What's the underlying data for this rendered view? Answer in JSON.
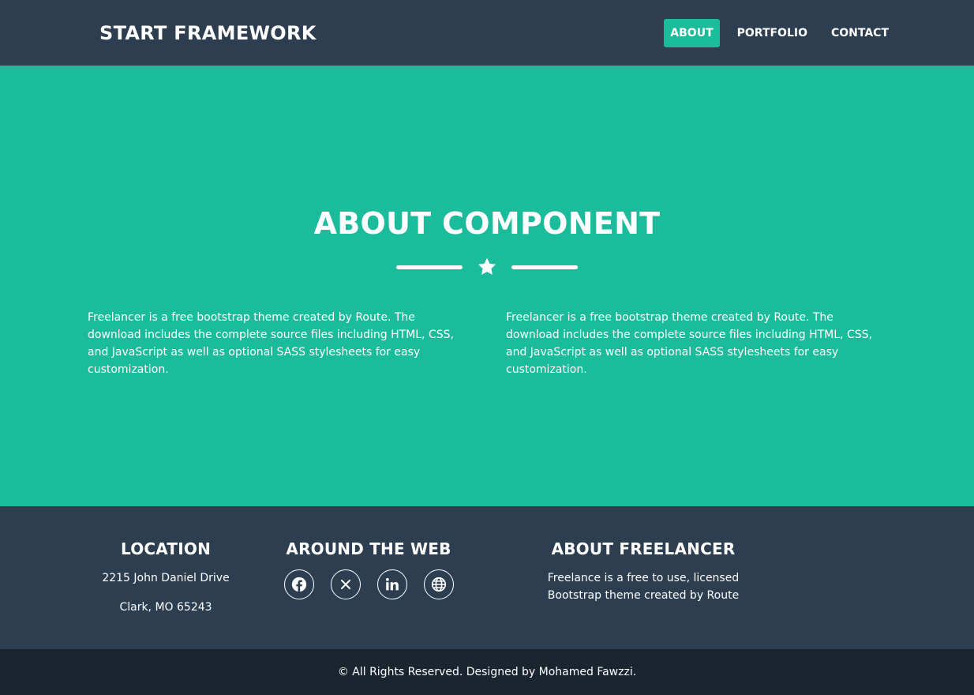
{
  "nav": {
    "brand": "START FRAMEWORK",
    "items": [
      {
        "label": "ABOUT",
        "active": true
      },
      {
        "label": "PORTFOLIO",
        "active": false
      },
      {
        "label": "CONTACT",
        "active": false
      }
    ]
  },
  "hero": {
    "title": "ABOUT COMPONENT",
    "divider_icon": "star-icon",
    "paragraphs": [
      "Freelancer is a free bootstrap theme created by Route. The download includes the complete source files including HTML, CSS, and JavaScript as well as optional SASS stylesheets for easy customization.",
      "Freelancer is a free bootstrap theme created by Route. The download includes the complete source files including HTML, CSS, and JavaScript as well as optional SASS stylesheets for easy customization."
    ]
  },
  "footer": {
    "location": {
      "title": "LOCATION",
      "line1": "2215 John Daniel Drive",
      "line2": "Clark, MO 65243"
    },
    "web": {
      "title": "AROUND THE WEB",
      "icons": [
        "facebook-icon",
        "x-icon",
        "linkedin-icon",
        "globe-icon"
      ]
    },
    "about": {
      "title": "ABOUT FREELANCER",
      "text": "Freelance is a free to use, licensed Bootstrap theme created by Route"
    }
  },
  "copyright": "© All Rights Reserved. Designed by Mohamed Fawzzi.",
  "colors": {
    "primary": "#1abc9c",
    "dark": "#2c3e50",
    "darker": "#1a252f"
  }
}
